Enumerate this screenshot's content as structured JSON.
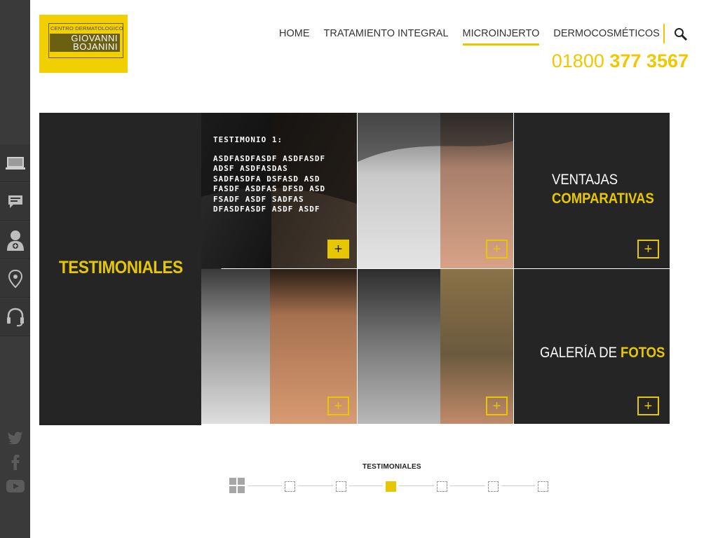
{
  "brand": {
    "small_text": "CENTRO DERMATOLOGICO",
    "name_line1": "GIOVANNI",
    "name_line2": "BOJANINI",
    "color": "#f2cf00"
  },
  "nav": {
    "items": [
      {
        "label": "HOME",
        "active": false
      },
      {
        "label": "TRATAMIENTO INTEGRAL",
        "active": false
      },
      {
        "label": "MICROINJERTO",
        "active": true
      },
      {
        "label": "DERMOCOSMÉTICOS",
        "active": false
      }
    ],
    "search_icon": "search-icon"
  },
  "phone": {
    "prefix": "01800",
    "number": "377 3567"
  },
  "sidebar": {
    "icons": [
      "laptop-icon",
      "chat-icon",
      "doctor-icon",
      "location-pin-icon",
      "headset-icon"
    ],
    "social": [
      "twitter-icon",
      "facebook-icon",
      "youtube-icon"
    ]
  },
  "testimonials": {
    "title": "TESTIMONIALES",
    "card_heading": "TESTIMONIO 1:",
    "card_body": "ASDFASDFASDF ASDFASDF\nADSF ASDFASDAS\nSADFASDFA DSFASD ASD\nFASDF ASDFAS DFSD ASD\nFSADF ASDF SADFAS\nDFASDFASDF ASDF ASDF"
  },
  "ventajas": {
    "line1": "VENTAJAS",
    "line2": "COMPARATIVAS"
  },
  "galeria": {
    "normal": "GALERÍA DE",
    "bold": "FOTOS"
  },
  "pager": {
    "label": "TESTIMONIALES",
    "count": 6,
    "active_index": 2
  },
  "colors": {
    "accent": "#e7c800",
    "dark_panel": "#252525",
    "sidebar": "#3a3a3a"
  }
}
